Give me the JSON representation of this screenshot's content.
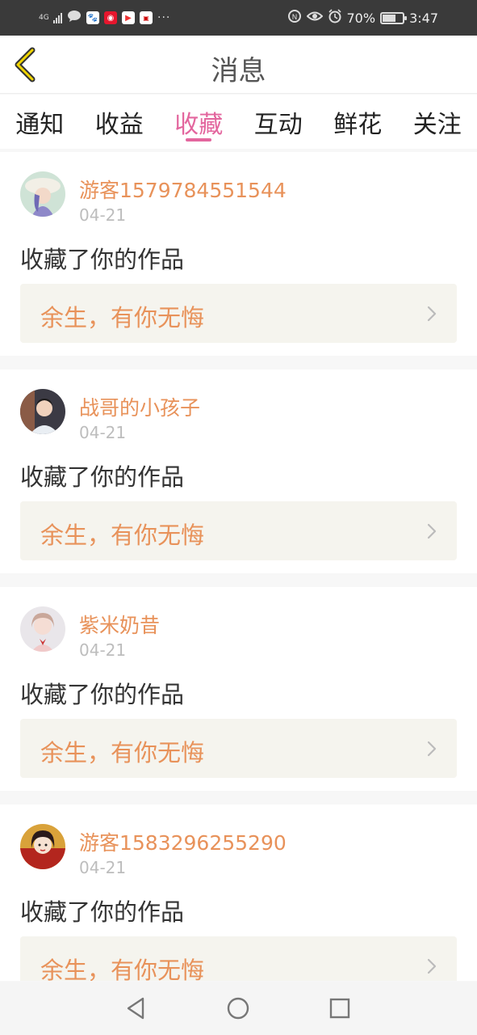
{
  "status_bar": {
    "network": "4G",
    "battery_percent": "70%",
    "battery_level": 0.7,
    "time": "3:47",
    "overflow": "···"
  },
  "header": {
    "title": "消息",
    "back_icon": "chevron-left-icon"
  },
  "tabs": [
    {
      "label": "通知",
      "active": false
    },
    {
      "label": "收益",
      "active": false
    },
    {
      "label": "收藏",
      "active": true
    },
    {
      "label": "互动",
      "active": false
    },
    {
      "label": "鲜花",
      "active": false
    },
    {
      "label": "关注",
      "active": false
    }
  ],
  "colors": {
    "accent": "#e3669e",
    "username": "#e8925a",
    "date": "#bdbdbd",
    "card_link_bg": "#f5f4ee"
  },
  "messages": [
    {
      "username": "游客1579784551544",
      "date": "04-21",
      "action": "收藏了你的作品",
      "work_title": "余生，有你无悔"
    },
    {
      "username": "战哥的小孩子",
      "date": "04-21",
      "action": "收藏了你的作品",
      "work_title": "余生，有你无悔"
    },
    {
      "username": "紫米奶昔",
      "date": "04-21",
      "action": "收藏了你的作品",
      "work_title": "余生，有你无悔"
    },
    {
      "username": "游客1583296255290",
      "date": "04-21",
      "action": "收藏了你的作品",
      "work_title": "余生，有你无悔"
    }
  ],
  "nav_bar": {
    "back_icon": "triangle-back-icon",
    "home_icon": "circle-home-icon",
    "recents_icon": "square-recents-icon"
  }
}
